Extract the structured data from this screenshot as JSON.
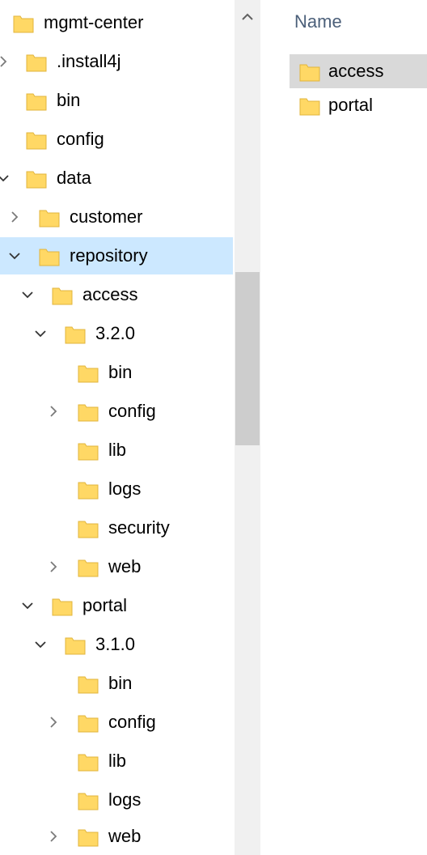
{
  "tree": {
    "items": [
      {
        "label": "mgmt-center",
        "chevron": "none"
      },
      {
        "label": ".install4j",
        "chevron": "right"
      },
      {
        "label": "bin",
        "chevron": "none"
      },
      {
        "label": "config",
        "chevron": "none"
      },
      {
        "label": "data",
        "chevron": "down"
      },
      {
        "label": "customer",
        "chevron": "right"
      },
      {
        "label": "repository",
        "chevron": "down",
        "selected": true
      },
      {
        "label": "access",
        "chevron": "down"
      },
      {
        "label": "3.2.0",
        "chevron": "down"
      },
      {
        "label": "bin",
        "chevron": "none"
      },
      {
        "label": "config",
        "chevron": "right"
      },
      {
        "label": "lib",
        "chevron": "none"
      },
      {
        "label": "logs",
        "chevron": "none"
      },
      {
        "label": "security",
        "chevron": "none"
      },
      {
        "label": "web",
        "chevron": "right"
      },
      {
        "label": "portal",
        "chevron": "down"
      },
      {
        "label": "3.1.0",
        "chevron": "down"
      },
      {
        "label": "bin",
        "chevron": "none"
      },
      {
        "label": "config",
        "chevron": "right"
      },
      {
        "label": "lib",
        "chevron": "none"
      },
      {
        "label": "logs",
        "chevron": "none"
      },
      {
        "label": "web",
        "chevron": "right"
      }
    ]
  },
  "content": {
    "column_header": "Name",
    "files": [
      {
        "label": "access",
        "hover": true
      },
      {
        "label": "portal",
        "hover": false
      }
    ]
  },
  "colors": {
    "selected_row": "#cce8ff",
    "folder_fill": "#ffd865",
    "folder_edge": "#e2b53c",
    "header_text": "#4c607a",
    "scrollbar_track": "#f0f0f0",
    "scrollbar_thumb": "#cdcdcd"
  },
  "icons": {
    "folder": "folder-icon",
    "expand": "chevron-right-icon",
    "collapse": "chevron-down-icon",
    "scroll_up": "scroll-up-arrow-icon"
  }
}
